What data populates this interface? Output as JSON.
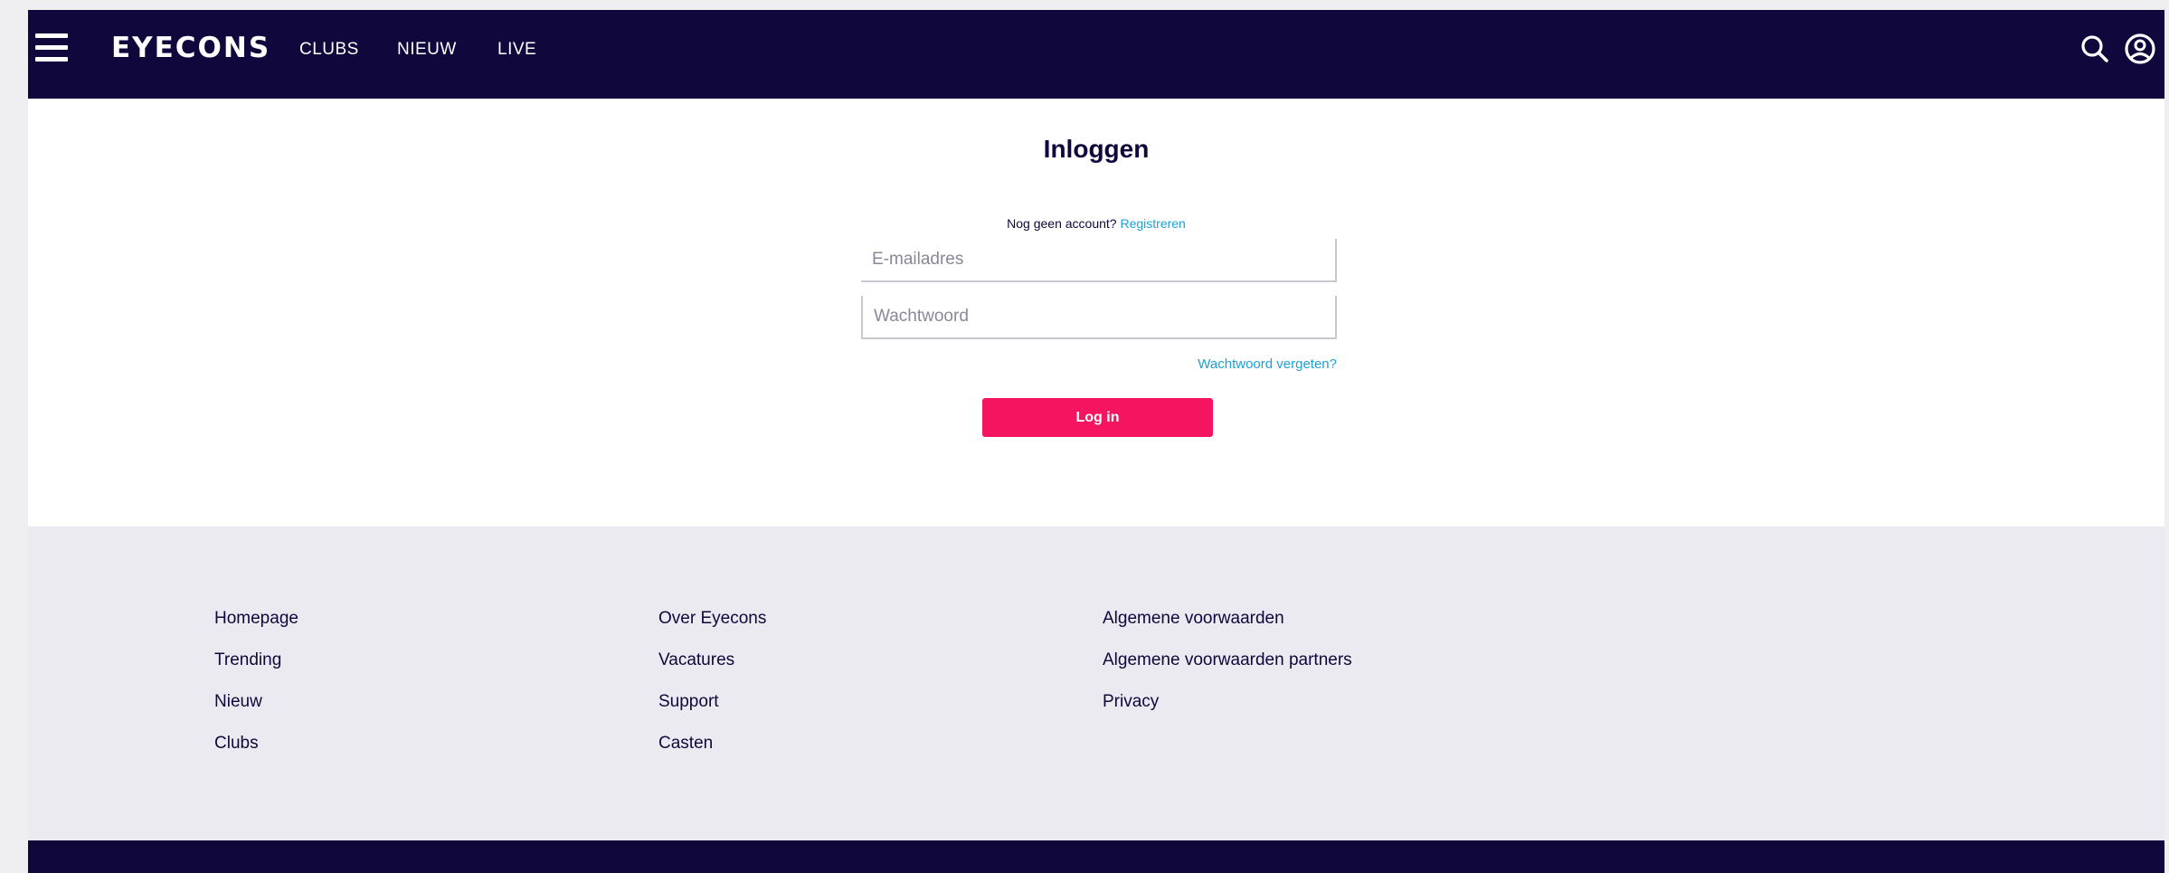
{
  "header": {
    "logo": "EYECONS",
    "nav": [
      "CLUBS",
      "NIEUW",
      "LIVE"
    ],
    "icons": [
      "menu-icon",
      "search-icon",
      "user-account-icon"
    ]
  },
  "login": {
    "title": "Inloggen",
    "no_account": "Nog geen account?",
    "register_link": "Registreren",
    "email_placeholder": "E-mailadres",
    "password_placeholder": "Wachtwoord",
    "forgot_link": "Wachtwoord vergeten?",
    "submit_label": "Log in"
  },
  "footer": {
    "col1": [
      "Homepage",
      "Trending",
      "Nieuw",
      "Clubs"
    ],
    "col2": [
      "Over Eyecons",
      "Vacatures",
      "Support",
      "Casten"
    ],
    "col3": [
      "Algemene voorwaarden",
      "Algemene voorwaarden partners",
      "Privacy"
    ]
  },
  "colors": {
    "navy": "#10073c",
    "accent_pink": "#f5145f",
    "link_blue": "#1ea0d6",
    "footer_bg": "#eaeaf0"
  }
}
